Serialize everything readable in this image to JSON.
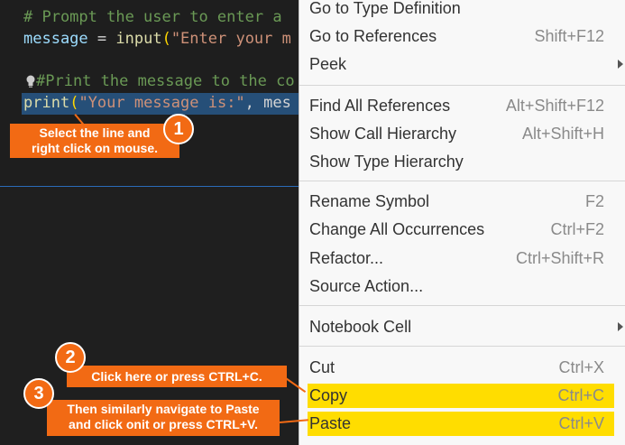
{
  "editor": {
    "line1": "# Prompt the user to enter a",
    "line2": {
      "var": "message",
      "eq": " = ",
      "fn": "input",
      "open": "(",
      "str": "\"Enter your m"
    },
    "line3": "#Print the message to the co",
    "line4": {
      "fn": "print",
      "open": "(",
      "str": "\"Your message is:\"",
      "rest": ", mes"
    }
  },
  "context_menu": {
    "items": [
      {
        "label": "Go to Type Definition",
        "shortcut": ""
      },
      {
        "label": "Go to References",
        "shortcut": "Shift+F12"
      },
      {
        "label": "Peek",
        "shortcut": ""
      },
      {
        "label": "Find All References",
        "shortcut": "Alt+Shift+F12"
      },
      {
        "label": "Show Call Hierarchy",
        "shortcut": "Alt+Shift+H"
      },
      {
        "label": "Show Type Hierarchy",
        "shortcut": ""
      },
      {
        "label": "Rename Symbol",
        "shortcut": "F2"
      },
      {
        "label": "Change All Occurrences",
        "shortcut": "Ctrl+F2"
      },
      {
        "label": "Refactor...",
        "shortcut": "Ctrl+Shift+R"
      },
      {
        "label": "Source Action...",
        "shortcut": ""
      },
      {
        "label": "Notebook Cell",
        "shortcut": ""
      },
      {
        "label": "Cut",
        "shortcut": "Ctrl+X"
      },
      {
        "label": "Copy",
        "shortcut": "Ctrl+C"
      },
      {
        "label": "Paste",
        "shortcut": "Ctrl+V"
      }
    ]
  },
  "annotations": {
    "step1": {
      "number": "1",
      "text_line1": "Select the line and",
      "text_line2": "right click on mouse."
    },
    "step2": {
      "number": "2",
      "text": "Click here or press CTRL+C."
    },
    "step3": {
      "number": "3",
      "text_line1": "Then similarly navigate to Paste",
      "text_line2": "and click onit or press CTRL+V."
    }
  },
  "colors": {
    "highlight": "#ffdd00",
    "callout": "#f26a14",
    "selection": "#264f78"
  }
}
